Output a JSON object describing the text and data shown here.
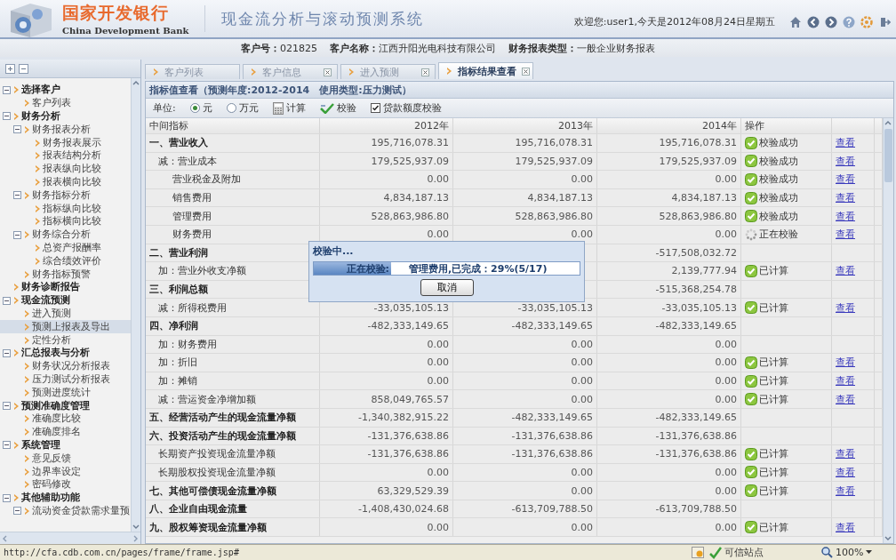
{
  "header": {
    "bank_name": "国家开发银行",
    "bank_name_en": "China Development Bank",
    "system_title": "现金流分析与滚动预测系统",
    "welcome": "欢迎您:user1,今天是2012年08月24日星期五"
  },
  "customer_info": [
    {
      "label": "客户号：",
      "value": "021825"
    },
    {
      "label": "客户名称：",
      "value": "江西升阳光电科技有限公司"
    },
    {
      "label": "财务报表类型：",
      "value": "一般企业财务报表"
    }
  ],
  "sidebar": {
    "items": [
      {
        "label": "选择客户",
        "expanded": true,
        "selected": false,
        "children": [
          {
            "label": "客户列表",
            "selected": false
          }
        ]
      },
      {
        "label": "财务分析",
        "expanded": true,
        "selected": false,
        "children": [
          {
            "label": "财务报表分析",
            "expanded": true,
            "selected": false,
            "children": [
              {
                "label": "财务报表展示",
                "selected": false
              },
              {
                "label": "报表结构分析",
                "selected": false
              },
              {
                "label": "报表纵向比较",
                "selected": false
              },
              {
                "label": "报表横向比较",
                "selected": false
              }
            ]
          },
          {
            "label": "财务指标分析",
            "expanded": true,
            "selected": false,
            "children": [
              {
                "label": "指标纵向比较",
                "selected": false
              },
              {
                "label": "指标横向比较",
                "selected": false
              }
            ]
          },
          {
            "label": "财务综合分析",
            "expanded": true,
            "selected": false,
            "children": [
              {
                "label": "总资产报酬率",
                "selected": false
              },
              {
                "label": "综合绩效评价",
                "selected": false
              }
            ]
          },
          {
            "label": "财务指标预警",
            "selected": false
          }
        ]
      },
      {
        "label": "财务诊断报告",
        "selected": false
      },
      {
        "label": "现金流预测",
        "expanded": true,
        "selected": false,
        "children": [
          {
            "label": "进入预测",
            "selected": false
          },
          {
            "label": "预测上报表及导出",
            "selected": true
          },
          {
            "label": "定性分析",
            "selected": false
          }
        ]
      },
      {
        "label": "汇总报表与分析",
        "expanded": true,
        "selected": false,
        "children": [
          {
            "label": "财务状况分析报表",
            "selected": false
          },
          {
            "label": "压力测试分析报表",
            "selected": false
          },
          {
            "label": "预测进度统计",
            "selected": false
          }
        ]
      },
      {
        "label": "预测准确度管理",
        "expanded": true,
        "selected": false,
        "children": [
          {
            "label": "准确度比较",
            "selected": false
          },
          {
            "label": "准确度排名",
            "selected": false
          }
        ]
      },
      {
        "label": "系统管理",
        "expanded": true,
        "selected": false,
        "children": [
          {
            "label": "意见反馈",
            "selected": false
          },
          {
            "label": "边界率设定",
            "selected": false
          },
          {
            "label": "密码修改",
            "selected": false
          }
        ]
      },
      {
        "label": "其他辅助功能",
        "expanded": true,
        "selected": false,
        "children": [
          {
            "label": "流动资金贷款需求量预",
            "expanded": true,
            "selected": false
          }
        ]
      }
    ]
  },
  "tabs": [
    {
      "label": "客户列表",
      "closable": false,
      "selected": false
    },
    {
      "label": "客户信息",
      "closable": true,
      "selected": false
    },
    {
      "label": "进入预测",
      "closable": true,
      "selected": false
    },
    {
      "label": "指标结果查看",
      "closable": true,
      "selected": true
    }
  ],
  "panel": {
    "title": "指标值查看（预测年度:2012-2014　使用类型:压力测试）",
    "unit_label": "单位:",
    "units": [
      {
        "label": "元",
        "selected": true
      },
      {
        "label": "万元",
        "selected": false
      }
    ],
    "buttons": [
      {
        "label": "计算",
        "kind": "calculator"
      },
      {
        "label": "校验",
        "kind": "check"
      }
    ],
    "checkbox": {
      "label": "贷款额度校验",
      "checked": true
    }
  },
  "table": {
    "columns": [
      "中间指标",
      "2012年",
      "2013年",
      "2014年",
      "操作"
    ],
    "rows": [
      {
        "kind": "heading",
        "label": "一、营业收入",
        "y2012": "195,716,078.31",
        "y2013": "195,716,078.31",
        "y2014": "195,716,078.31",
        "status": {
          "kind": "ok",
          "text": "校验成功"
        },
        "link": "查看"
      },
      {
        "kind": "sub",
        "label": "减：营业成本",
        "y2012": "179,525,937.09",
        "y2013": "179,525,937.09",
        "y2014": "179,525,937.09",
        "status": {
          "kind": "ok",
          "text": "校验成功"
        },
        "link": "查看"
      },
      {
        "kind": "item",
        "label": "营业税金及附加",
        "y2012": "0.00",
        "y2013": "0.00",
        "y2014": "0.00",
        "status": {
          "kind": "ok",
          "text": "校验成功"
        },
        "link": "查看"
      },
      {
        "kind": "item",
        "label": "销售费用",
        "y2012": "4,834,187.13",
        "y2013": "4,834,187.13",
        "y2014": "4,834,187.13",
        "status": {
          "kind": "ok",
          "text": "校验成功"
        },
        "link": "查看"
      },
      {
        "kind": "item",
        "label": "管理费用",
        "y2012": "528,863,986.80",
        "y2013": "528,863,986.80",
        "y2014": "528,863,986.80",
        "status": {
          "kind": "ok",
          "text": "校验成功"
        },
        "link": "查看"
      },
      {
        "kind": "item",
        "label": "财务费用",
        "y2012": "0.00",
        "y2013": "0.00",
        "y2014": "0.00",
        "status": {
          "kind": "pending",
          "text": "正在校验"
        },
        "link": "查看"
      },
      {
        "kind": "heading",
        "label": "二、营业利润",
        "y2014": "-517,508,032.72"
      },
      {
        "kind": "sub",
        "label": "加：营业外收支净额",
        "y2014": "2,139,777.94",
        "status": {
          "kind": "done",
          "text": "已计算"
        },
        "link": "查看"
      },
      {
        "kind": "heading",
        "label": "三、利润总额",
        "y2014": "-515,368,254.78"
      },
      {
        "kind": "sub",
        "label": "减：所得税费用",
        "y2012": "-33,035,105.13",
        "y2013": "-33,035,105.13",
        "y2014": "-33,035,105.13",
        "status": {
          "kind": "done",
          "text": "已计算"
        },
        "link": "查看"
      },
      {
        "kind": "heading",
        "label": "四、净利润",
        "y2012": "-482,333,149.65",
        "y2013": "-482,333,149.65",
        "y2014": "-482,333,149.65"
      },
      {
        "kind": "sub",
        "label": "加：财务费用",
        "y2012": "0.00",
        "y2013": "0.00",
        "y2014": "0.00"
      },
      {
        "kind": "sub",
        "label": "加：折旧",
        "y2012": "0.00",
        "y2013": "0.00",
        "y2014": "0.00",
        "status": {
          "kind": "done",
          "text": "已计算"
        },
        "link": "查看"
      },
      {
        "kind": "sub",
        "label": "加：摊销",
        "y2012": "0.00",
        "y2013": "0.00",
        "y2014": "0.00",
        "status": {
          "kind": "done",
          "text": "已计算"
        },
        "link": "查看"
      },
      {
        "kind": "sub",
        "label": "减：营运资金净增加额",
        "y2012": "858,049,765.57",
        "y2013": "0.00",
        "y2014": "0.00",
        "status": {
          "kind": "done",
          "text": "已计算"
        },
        "link": "查看"
      },
      {
        "kind": "heading",
        "label": "五、经营活动产生的现金流量净额",
        "y2012": "-1,340,382,915.22",
        "y2013": "-482,333,149.65",
        "y2014": "-482,333,149.65"
      },
      {
        "kind": "heading",
        "label": "六、投资活动产生的现金流量净额",
        "y2012": "-131,376,638.86",
        "y2013": "-131,376,638.86",
        "y2014": "-131,376,638.86"
      },
      {
        "kind": "sub",
        "label": "长期资产投资现金流量净额",
        "y2012": "-131,376,638.86",
        "y2013": "-131,376,638.86",
        "y2014": "-131,376,638.86",
        "status": {
          "kind": "done",
          "text": "已计算"
        },
        "link": "查看"
      },
      {
        "kind": "sub",
        "label": "长期股权投资现金流量净额",
        "y2012": "0.00",
        "y2013": "0.00",
        "y2014": "0.00",
        "status": {
          "kind": "done",
          "text": "已计算"
        },
        "link": "查看"
      },
      {
        "kind": "heading",
        "label": "七、其他可偿债现金流量净额",
        "y2012": "63,329,529.39",
        "y2013": "0.00",
        "y2014": "0.00",
        "status": {
          "kind": "done",
          "text": "已计算"
        },
        "link": "查看"
      },
      {
        "kind": "heading",
        "label": "八、企业自由现金流量",
        "y2012": "-1,408,430,024.68",
        "y2013": "-613,709,788.50",
        "y2014": "-613,709,788.50"
      },
      {
        "kind": "heading",
        "label": "九、股权筹资现金流量净额",
        "y2012": "0.00",
        "y2013": "0.00",
        "y2014": "0.00",
        "status": {
          "kind": "done",
          "text": "已计算"
        },
        "link": "查看"
      }
    ]
  },
  "dialog": {
    "title": "校验中...",
    "message": "正在校验:　　管理费用,已完成：29%(5/17)",
    "level": 0.29,
    "button": "取消"
  },
  "status_bar": {
    "url": "http://cfa.cdb.com.cn/pages/frame/frame.jsp#",
    "zone": "可信站点",
    "zoom": "100%"
  }
}
